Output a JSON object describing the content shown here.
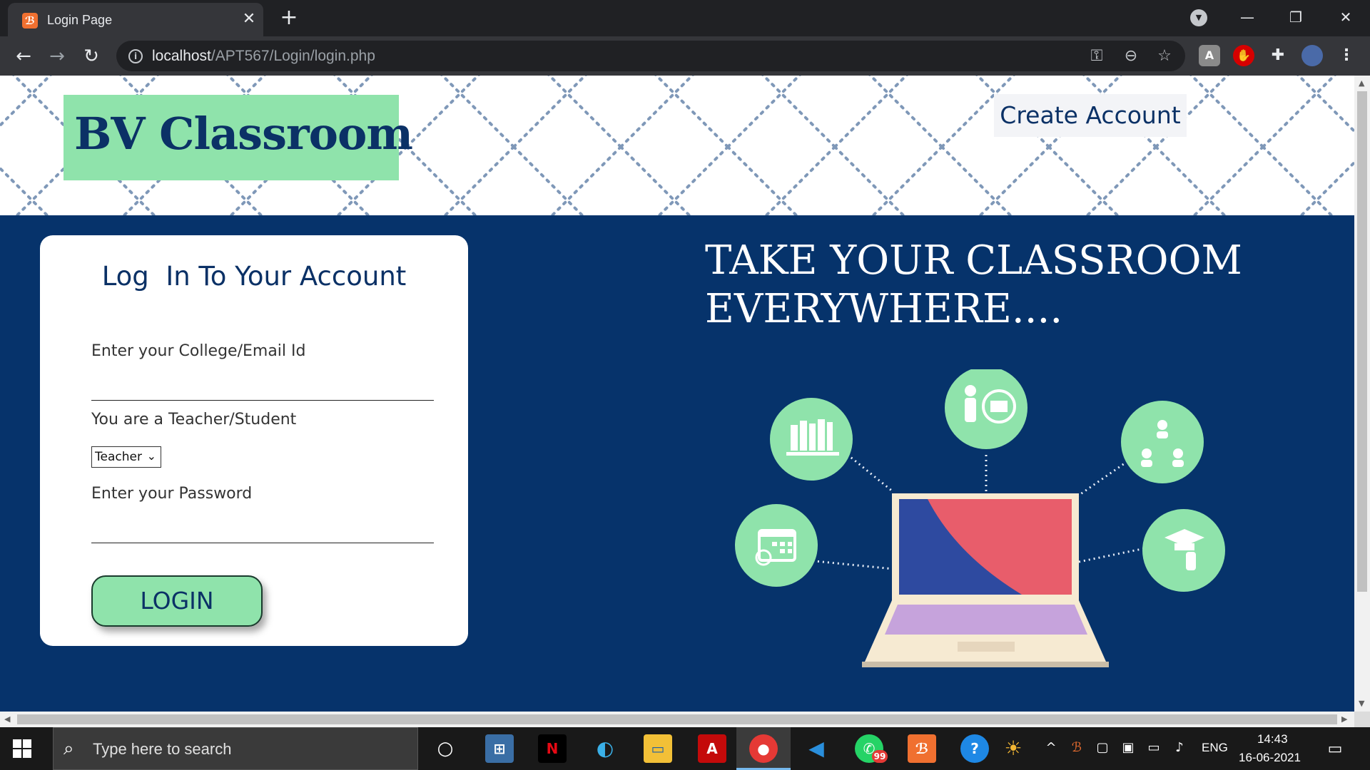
{
  "browser": {
    "tab_title": "Login Page",
    "favicon_glyph": "Ḟ",
    "new_tab": "+",
    "close_tab": "✕",
    "url_host": "localhost",
    "url_path": "/APT567/Login/login.php",
    "win_minimize": "—",
    "win_restore": "❐",
    "win_close": "✕"
  },
  "header": {
    "brand": "BV Classroom",
    "create_account": "Create Account"
  },
  "login_card": {
    "title": "Log  In To Your Account",
    "email_label": "Enter your College/Email Id",
    "email_value": "",
    "role_label": "You are a Teacher/Student",
    "role_selected": "Teacher",
    "password_label": "Enter your Password",
    "password_value": "",
    "login_button": "LOGIN"
  },
  "hero": {
    "headline_line1": "TAKE YOUR CLASSROOM",
    "headline_line2": "EVERYWHERE...."
  },
  "taskbar": {
    "search_placeholder": "Type here to search",
    "whatsapp_badge": "99",
    "language": "ENG",
    "time": "14:43",
    "date": "16-06-2021"
  },
  "colors": {
    "brand_green": "#8fe3ab",
    "navy": "#06336b",
    "brand_text": "#0b3166"
  }
}
